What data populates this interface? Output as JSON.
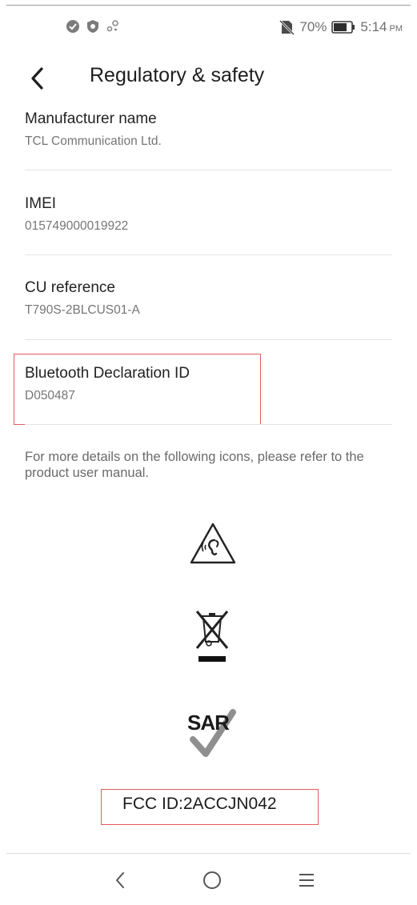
{
  "status_bar": {
    "notification_icons": [
      "check-circle-icon",
      "shield-icon",
      "settings-dots-icon"
    ],
    "no_sim_icon": "no-sim-icon",
    "battery_percent": "70%",
    "battery_icon": "battery-icon",
    "time": "5:14",
    "ampm": "PM"
  },
  "toolbar": {
    "back_icon": "back-arrow-icon",
    "title": "Regulatory & safety"
  },
  "items": [
    {
      "title": "Manufacturer name",
      "value": "TCL Communication Ltd."
    },
    {
      "title": "IMEI",
      "value": "015749000019922"
    },
    {
      "title": "CU reference",
      "value": "T790S-2BLCUS01-A"
    },
    {
      "title": "Bluetooth Declaration ID",
      "value": "D050487"
    }
  ],
  "note": "For more details on the following icons, please refer to the product user manual.",
  "icons": {
    "hearing": "hearing-warning-icon",
    "weee": "weee-crossed-bin-icon",
    "sar_text": "SAR",
    "sar_icon": "sar-checkmark-icon"
  },
  "fcc_id": "FCC ID:2ACCJN042",
  "nav_bar": {
    "back": "nav-back-icon",
    "home": "nav-home-icon",
    "recents": "nav-menu-icon"
  },
  "colors": {
    "highlight": "#e35b5b",
    "text_primary": "#212121",
    "text_secondary": "#767676"
  }
}
